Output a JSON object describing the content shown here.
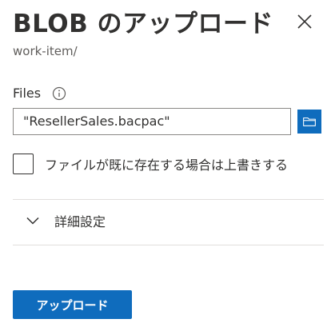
{
  "header": {
    "title": "BLOB のアップロード",
    "close_icon": "close-icon"
  },
  "subtitle": "work-item/",
  "files": {
    "label": "Files",
    "info_icon": "info-icon",
    "value": "\"ResellerSales.bacpac\"",
    "browse_icon": "folder-icon"
  },
  "overwrite": {
    "label": "ファイルが既に存在する場合は上書きする",
    "checked": false
  },
  "advanced": {
    "label": "詳細設定",
    "expanded": false,
    "chevron_icon": "chevron-down-icon"
  },
  "actions": {
    "upload_label": "アップロード"
  },
  "colors": {
    "accent": "#0f6cbd",
    "text": "#323130",
    "subtle_text": "#605e5c",
    "divider": "#e1dfdd"
  }
}
